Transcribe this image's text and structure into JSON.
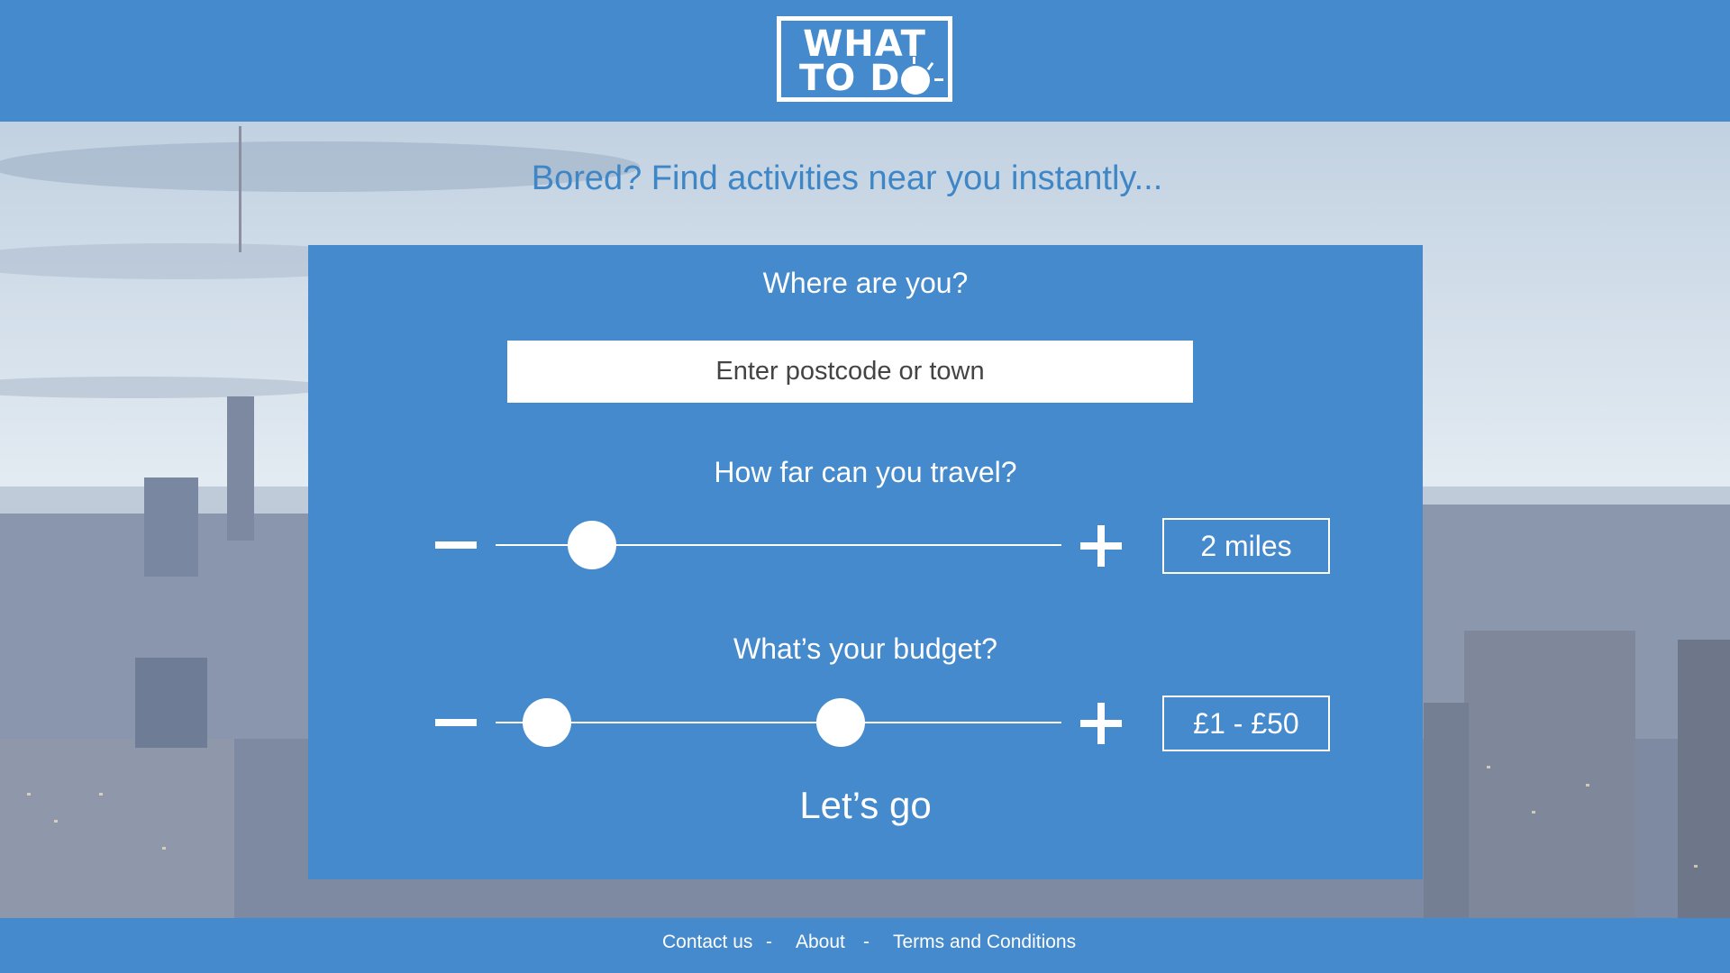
{
  "header": {
    "logo_line1": "WHAT",
    "logo_line2": "TO D"
  },
  "tagline": "Bored? Find activities near you instantly...",
  "form": {
    "location_question": "Where are you?",
    "location_placeholder": "Enter postcode or town",
    "distance_question": "How far can you travel?",
    "distance_value": "2 miles",
    "distance_level": 0.17,
    "budget_question": "What’s your budget?",
    "budget_value": "£1 - £50",
    "budget_range": [
      0.09,
      0.61
    ],
    "submit_label": "Let’s go"
  },
  "footer": {
    "contact": "Contact us",
    "sep1": "-",
    "about": "About",
    "sep2": "-",
    "terms": "Terms and Conditions"
  },
  "colors": {
    "primary": "#448acd",
    "tagline": "#3f86c6",
    "white": "#ffffff"
  },
  "icons": {
    "minus": "minus-icon",
    "plus": "plus-icon"
  }
}
